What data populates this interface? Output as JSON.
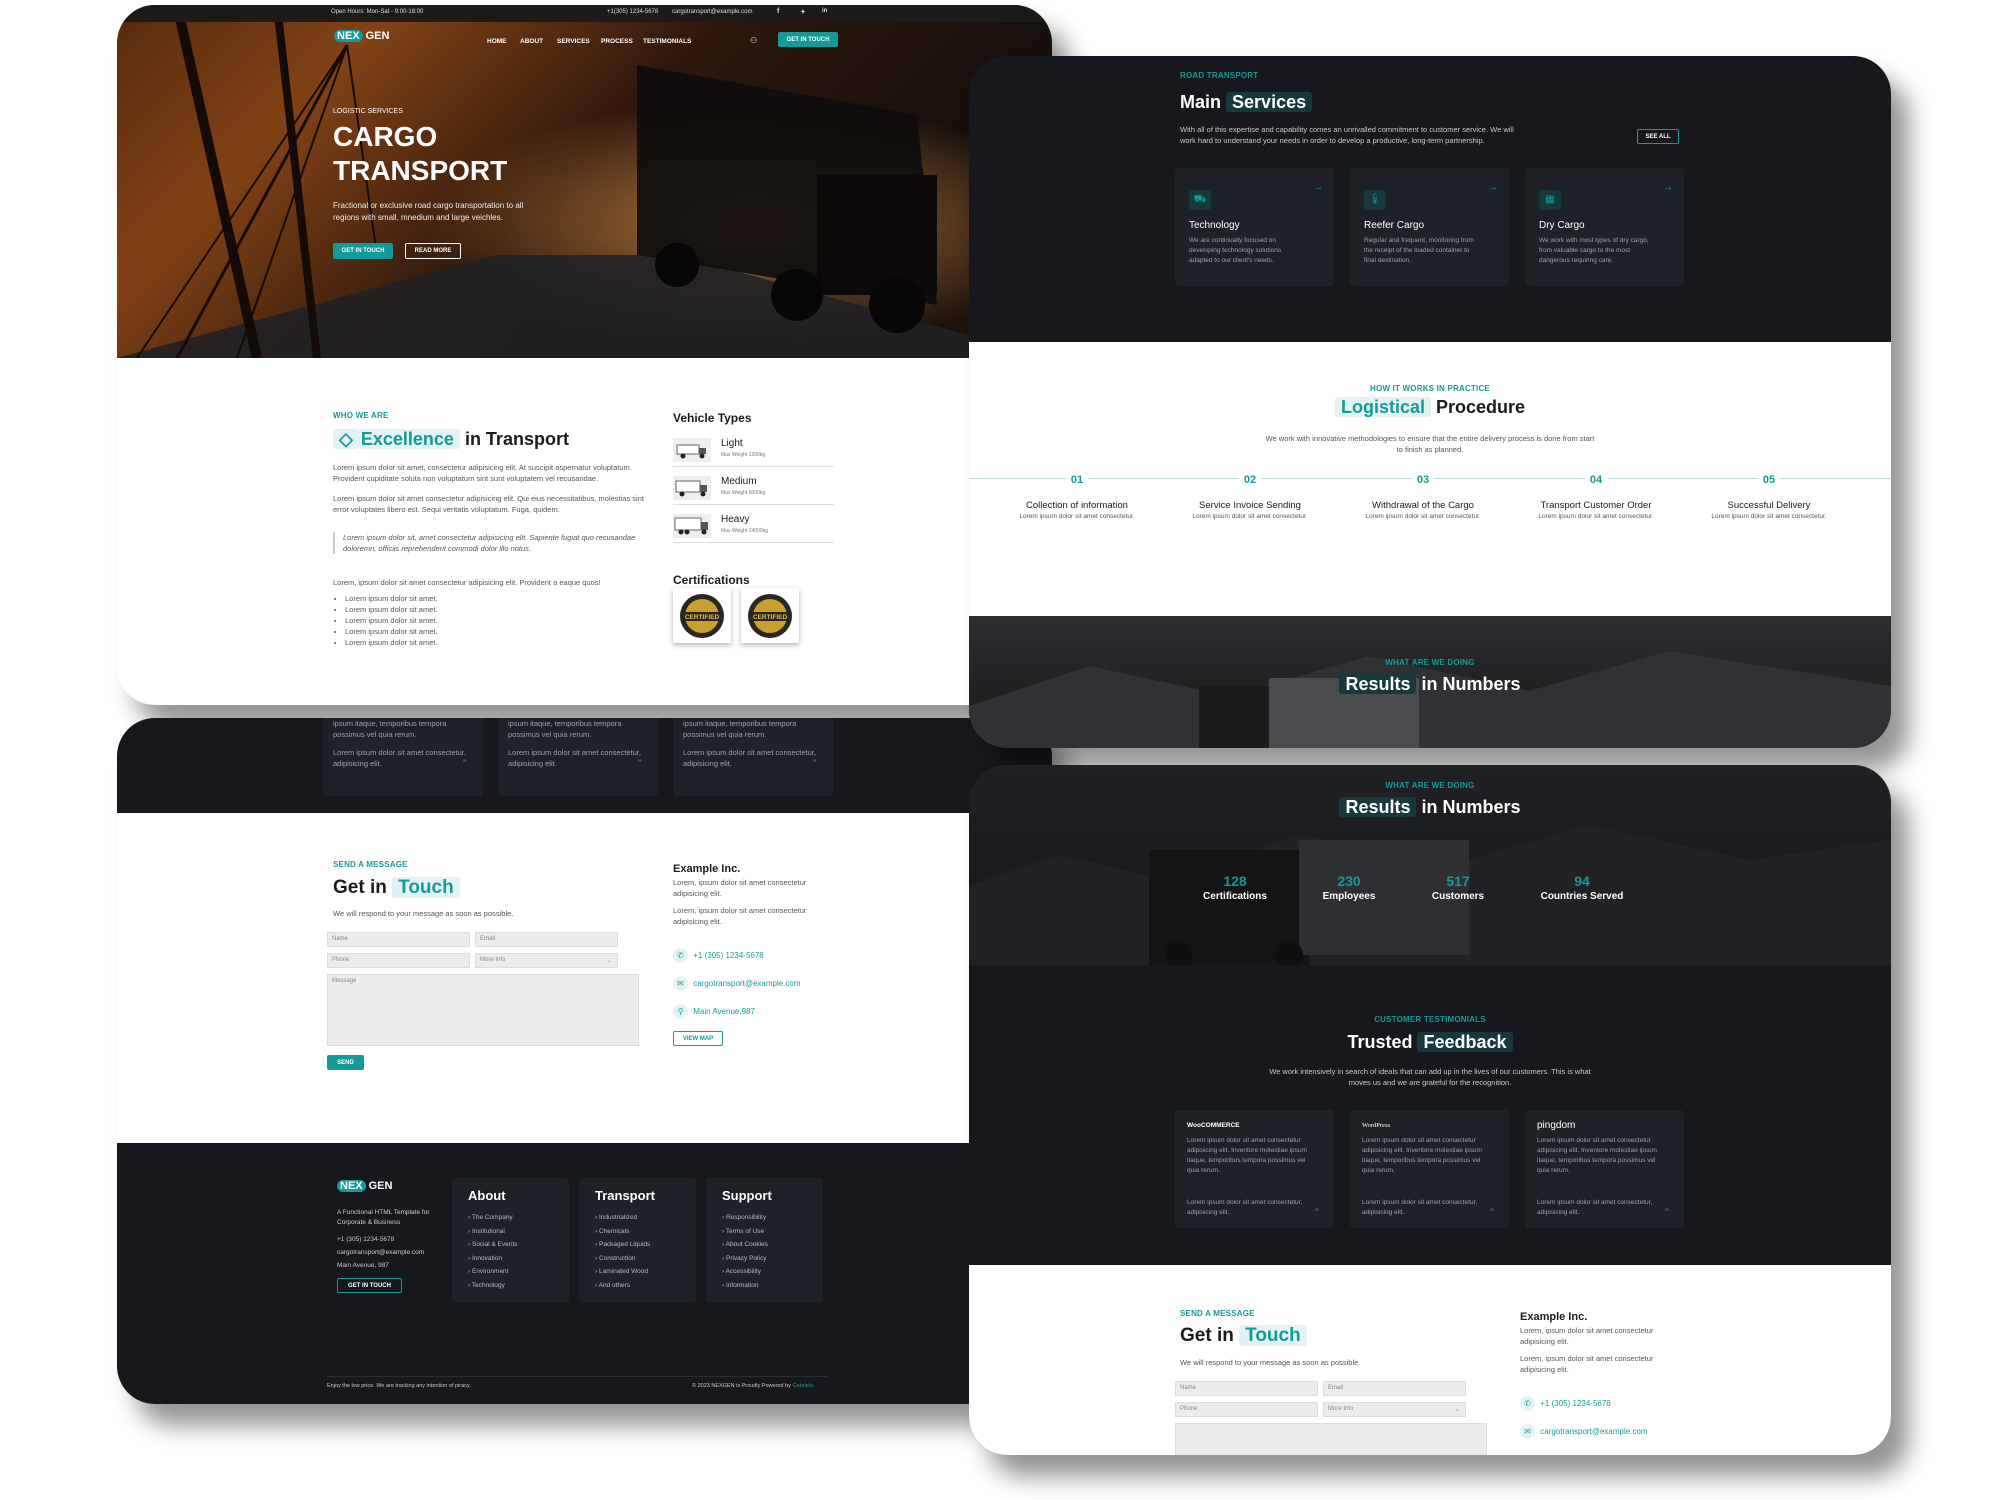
{
  "hero": {
    "topbar": {
      "hours": "Open Hours: Mon-Sat - 9:00-18:00",
      "phone": "+1(305) 1234-5678",
      "email": "cargotransport@example.com",
      "social": [
        "facebook-icon",
        "twitter-icon",
        "linkedin-icon"
      ]
    },
    "logo": {
      "part1": "NEX",
      "part2": "GEN"
    },
    "nav": [
      "HOME",
      "ABOUT",
      "SERVICES",
      "PROCESS",
      "TESTIMONIALS"
    ],
    "nav_cta": "GET IN TOUCH",
    "eyebrow": "LOGISTIC SERVICES",
    "title_line1": "CARGO",
    "title_line2": "TRANSPORT",
    "desc": "Fractional or exclusive road cargo transportation to all regions with small, mnedium and large veichles.",
    "btn_primary": "GET IN TOUCH",
    "btn_secondary": "READ MORE"
  },
  "about": {
    "eyebrow": "WHO WE ARE",
    "title_hl": "Excellence",
    "title_rest": "in Transport",
    "p1": "Lorem ipsum dolor sit amet, consectetur adipisicing elit. At suscipit aspernatur voluptatum. Provident cupiditate soluta non voluptatum sint sunt voluptatem vel recusandae.",
    "p2": "Lorem ipsum dolor sit amet consectetur adipisicing elit. Qui eius necessitatibus, molestias sint error voluptates libero est. Sequi veritatis voluptatum. Fuga, quidem.",
    "quote": "Lorem ipsum dolor sit, amet consectetur adipisicing elit. Sapiente fugiat quo recusandae doloremn, officiis reprehenderit commodi dolor illo notus.",
    "p3": "Lorem, ipsum dolor sit amet consectetur adipisicing elit. Provident a eaque quos!",
    "list": [
      "Lorem ipsum dolor sit amet.",
      "Lorem ipsum dolor sit amet.",
      "Lorem ipsum dolor sit amet.",
      "Lorem ipsum dolor sit amet.",
      "Lorem ipsum dolor sit amet."
    ],
    "vehicles_title": "Vehicle Types",
    "vehicles": [
      {
        "name": "Light",
        "sub": "Max Weight 1200kg"
      },
      {
        "name": "Medium",
        "sub": "Max Weight 6000kg"
      },
      {
        "name": "Heavy",
        "sub": "Max Weight 24000kg"
      }
    ],
    "cert_title": "Certifications",
    "badge_text": "CERTIFIED"
  },
  "testimonial_snippets": [
    {
      "t1": "ipsum itaque, temporibus tempora",
      "t2": "possimus vel quia rerum.",
      "t3": "Lorem ipsum dolor sit amet consectetur,",
      "t4": "adipisicing elit."
    },
    {
      "t1": "ipsum itaque, temporibus tempora",
      "t2": "possimus vel quia rerum.",
      "t3": "Lorem ipsum dolor sit amet consectetur,",
      "t4": "adipisicing elit."
    },
    {
      "t1": "ipsum itaque, temporibus tempora",
      "t2": "possimus vel quia rerum.",
      "t3": "Lorem ipsum dolor sit amet consectetur,",
      "t4": "adipisicing elit."
    }
  ],
  "contact": {
    "eyebrow": "SEND A MESSAGE",
    "title_a": "Get in",
    "title_hl": "Touch",
    "sub": "We will respond to your message as soon as possible.",
    "ph_name": "Name",
    "ph_email": "Email",
    "ph_phone": "Phone",
    "select_value": "More Info",
    "ph_message": "Message",
    "send": "SEND",
    "company": "Example Inc.",
    "c1": "Lorem, ipsum dolor sit amet consectetur adipisicing elit.",
    "c2": "Lorem, ipsum dolor sit amet consectetur adipisicing elit.",
    "phone": "+1 (305) 1234-5678",
    "email": "cargotransport@example.com",
    "address": "Main Avenue,987",
    "view_map": "VIEW MAP"
  },
  "footer": {
    "tagline": "A Functional HTML Template for Corporate & Business",
    "phone": "+1 (305) 1234-5678",
    "email": "cargotransport@example.com",
    "address": "Main Avenue, 987",
    "cta": "GET IN TOUCH",
    "cols": [
      {
        "title": "About",
        "items": [
          "The Company",
          "Institutional",
          "Social & Events",
          "Innovation",
          "Environment",
          "Technology"
        ]
      },
      {
        "title": "Transport",
        "items": [
          "Industrialized",
          "Chemicals",
          "Packaged Liquids",
          "Construction",
          "Laminated Wood",
          "And others"
        ]
      },
      {
        "title": "Support",
        "items": [
          "Responsibility",
          "Terms of Use",
          "About Cookies",
          "Privacy Policy",
          "Accessibility",
          "Information"
        ]
      }
    ],
    "bottom_left": "Enjoy the low price. We are tracking any intention of piracy.",
    "bottom_right": "© 2023 NEXGEN is Proudly Powered by",
    "bottom_link": "Gabriela"
  },
  "services": {
    "eyebrow": "ROAD TRANSPORT",
    "title_a": "Main",
    "title_hl": "Services",
    "desc": "With all of this expertise and capability comes an unrivalled commitment to customer service. We will work hard to understand your needs in order to develop a productive, long-term partnership.",
    "see_all": "SEE ALL",
    "cards": [
      {
        "icon": "truck-icon",
        "title": "Technology",
        "desc": "We are continually focused on developing technology solutions adapted to our client's needs."
      },
      {
        "icon": "thermometer-icon",
        "title": "Reefer Cargo",
        "desc": "Regular and frequent, monitoring from the receipt of the loaded container to final destination."
      },
      {
        "icon": "box-icon",
        "title": "Dry Cargo",
        "desc": "We work with most types of dry cargo, from valuable cargo to the most dangerous requiring care."
      }
    ]
  },
  "process": {
    "eyebrow": "HOW IT WORKS IN PRACTICE",
    "title_hl": "Logistical",
    "title_rest": "Procedure",
    "desc": "We work with innovative methodologies to ensure that the entire delivery process is done from start to finish as planned.",
    "steps": [
      {
        "num": "01",
        "title": "Collection of information",
        "desc": "Lorem ipsum dolor sit amet consectetur."
      },
      {
        "num": "02",
        "title": "Service Invoice Sending",
        "desc": "Lorem ipsum dolor sit amet consectetur."
      },
      {
        "num": "03",
        "title": "Withdrawal of the Cargo",
        "desc": "Lorem ipsum dolor sit amet consectetur."
      },
      {
        "num": "04",
        "title": "Transport Customer Order",
        "desc": "Lorem ipsum dolor sit amet consectetur."
      },
      {
        "num": "05",
        "title": "Successful Delivery",
        "desc": "Lorem ipsum dolor sit amet consectetur."
      }
    ]
  },
  "numbers": {
    "eyebrow": "WHAT ARE WE DOING",
    "title_hl": "Results",
    "title_rest": "in Numbers",
    "stats": [
      {
        "value": "128",
        "label": "Certifications"
      },
      {
        "value": "230",
        "label": "Employees"
      },
      {
        "value": "517",
        "label": "Customers"
      },
      {
        "value": "94",
        "label": "Countries Served"
      }
    ]
  },
  "testimonials": {
    "eyebrow": "CUSTOMER TESTIMONIALS",
    "title_a": "Trusted",
    "title_hl": "Feedback",
    "desc": "We work intensively in search of ideals that can add up in the lives of our customers. This is what moves us and we are grateful for the recognition.",
    "cards": [
      {
        "brand": "WooCOMMERCE",
        "text": "Lorem ipsum dolor sit amet consectetur adipisicing elit. Inventore molestiae ipsum itaque, temporibus tempora possimus vel quia rerum.",
        "text2": "Lorem ipsum dolor sit amet consectetur, adipisicing elit."
      },
      {
        "brand": "WordPress",
        "text": "Lorem ipsum dolor sit amet consectetur adipisicing elit. Inventore molestiae ipsum itaque, temporibus tempora possimus vel quia rerum.",
        "text2": "Lorem ipsum dolor sit amet consectetur, adipisicing elit."
      },
      {
        "brand": "pingdom",
        "text": "Lorem ipsum dolor sit amet consectetur adipisicing elit. Inventore molestiae ipsum itaque, temporibus tempora possimus vel quia rerum.",
        "text2": "Lorem ipsum dolor sit amet consectetur, adipisicing elit."
      }
    ]
  },
  "colors": {
    "accent": "#149a9a",
    "dark": "#17181d",
    "card": "#1f2128"
  }
}
